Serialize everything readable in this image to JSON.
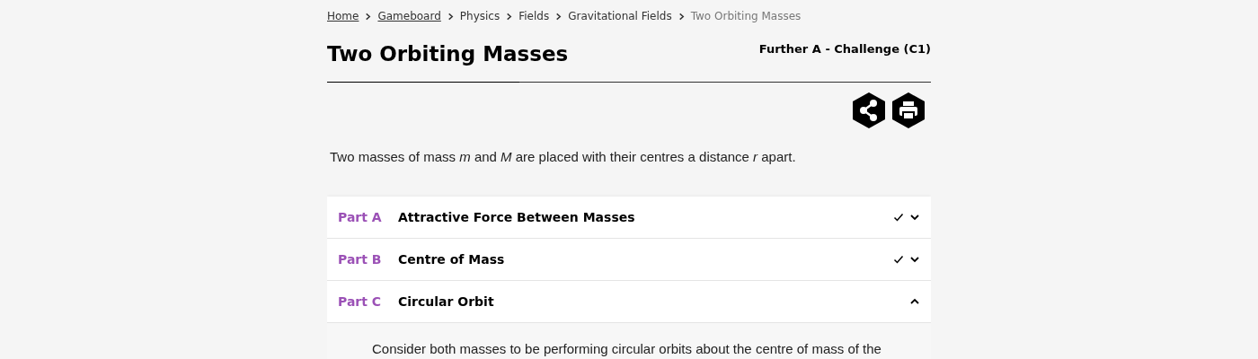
{
  "breadcrumb": [
    {
      "label": "Home",
      "link": true
    },
    {
      "label": "Gameboard",
      "link": true
    },
    {
      "label": "Physics",
      "link": false
    },
    {
      "label": "Fields",
      "link": false
    },
    {
      "label": "Gravitational Fields",
      "link": false
    },
    {
      "label": "Two Orbiting Masses",
      "link": false,
      "current": true
    }
  ],
  "title": "Two Orbiting Masses",
  "level": "Further A - Challenge (C1)",
  "intro": "Two masses of mass *m* and *M* are placed with their centres a distance *r* apart.",
  "parts": [
    {
      "label": "Part A",
      "title": "Attractive Force Between Masses",
      "completed": true,
      "expanded": false
    },
    {
      "label": "Part B",
      "title": "Centre of Mass",
      "completed": true,
      "expanded": false
    },
    {
      "label": "Part C",
      "title": "Circular Orbit",
      "completed": false,
      "expanded": true,
      "body": "Consider both masses to be performing circular orbits about the centre of mass of the"
    }
  ]
}
